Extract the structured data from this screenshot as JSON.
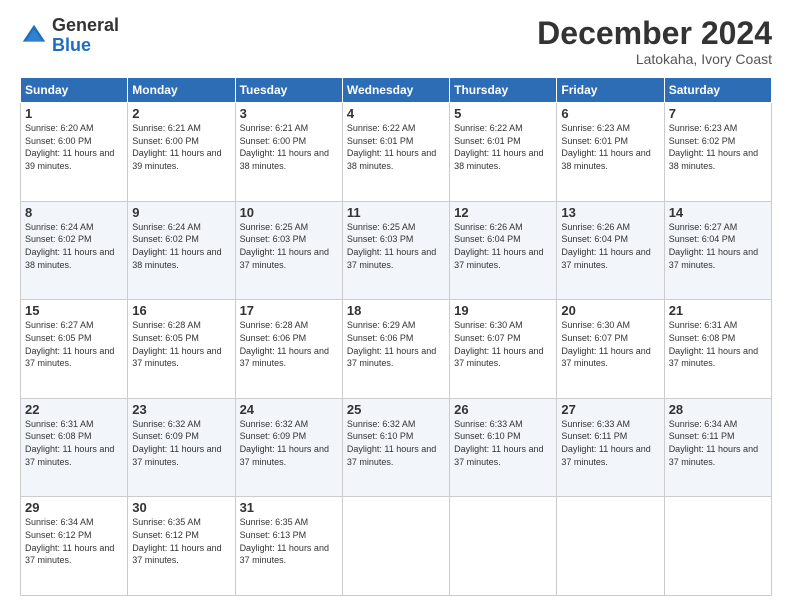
{
  "logo": {
    "general": "General",
    "blue": "Blue"
  },
  "header": {
    "month": "December 2024",
    "location": "Latokaha, Ivory Coast"
  },
  "weekdays": [
    "Sunday",
    "Monday",
    "Tuesday",
    "Wednesday",
    "Thursday",
    "Friday",
    "Saturday"
  ],
  "weeks": [
    [
      {
        "day": "1",
        "sunrise": "6:20 AM",
        "sunset": "6:00 PM",
        "daylight": "11 hours and 39 minutes."
      },
      {
        "day": "2",
        "sunrise": "6:21 AM",
        "sunset": "6:00 PM",
        "daylight": "11 hours and 39 minutes."
      },
      {
        "day": "3",
        "sunrise": "6:21 AM",
        "sunset": "6:00 PM",
        "daylight": "11 hours and 38 minutes."
      },
      {
        "day": "4",
        "sunrise": "6:22 AM",
        "sunset": "6:01 PM",
        "daylight": "11 hours and 38 minutes."
      },
      {
        "day": "5",
        "sunrise": "6:22 AM",
        "sunset": "6:01 PM",
        "daylight": "11 hours and 38 minutes."
      },
      {
        "day": "6",
        "sunrise": "6:23 AM",
        "sunset": "6:01 PM",
        "daylight": "11 hours and 38 minutes."
      },
      {
        "day": "7",
        "sunrise": "6:23 AM",
        "sunset": "6:02 PM",
        "daylight": "11 hours and 38 minutes."
      }
    ],
    [
      {
        "day": "8",
        "sunrise": "6:24 AM",
        "sunset": "6:02 PM",
        "daylight": "11 hours and 38 minutes."
      },
      {
        "day": "9",
        "sunrise": "6:24 AM",
        "sunset": "6:02 PM",
        "daylight": "11 hours and 38 minutes."
      },
      {
        "day": "10",
        "sunrise": "6:25 AM",
        "sunset": "6:03 PM",
        "daylight": "11 hours and 37 minutes."
      },
      {
        "day": "11",
        "sunrise": "6:25 AM",
        "sunset": "6:03 PM",
        "daylight": "11 hours and 37 minutes."
      },
      {
        "day": "12",
        "sunrise": "6:26 AM",
        "sunset": "6:04 PM",
        "daylight": "11 hours and 37 minutes."
      },
      {
        "day": "13",
        "sunrise": "6:26 AM",
        "sunset": "6:04 PM",
        "daylight": "11 hours and 37 minutes."
      },
      {
        "day": "14",
        "sunrise": "6:27 AM",
        "sunset": "6:04 PM",
        "daylight": "11 hours and 37 minutes."
      }
    ],
    [
      {
        "day": "15",
        "sunrise": "6:27 AM",
        "sunset": "6:05 PM",
        "daylight": "11 hours and 37 minutes."
      },
      {
        "day": "16",
        "sunrise": "6:28 AM",
        "sunset": "6:05 PM",
        "daylight": "11 hours and 37 minutes."
      },
      {
        "day": "17",
        "sunrise": "6:28 AM",
        "sunset": "6:06 PM",
        "daylight": "11 hours and 37 minutes."
      },
      {
        "day": "18",
        "sunrise": "6:29 AM",
        "sunset": "6:06 PM",
        "daylight": "11 hours and 37 minutes."
      },
      {
        "day": "19",
        "sunrise": "6:30 AM",
        "sunset": "6:07 PM",
        "daylight": "11 hours and 37 minutes."
      },
      {
        "day": "20",
        "sunrise": "6:30 AM",
        "sunset": "6:07 PM",
        "daylight": "11 hours and 37 minutes."
      },
      {
        "day": "21",
        "sunrise": "6:31 AM",
        "sunset": "6:08 PM",
        "daylight": "11 hours and 37 minutes."
      }
    ],
    [
      {
        "day": "22",
        "sunrise": "6:31 AM",
        "sunset": "6:08 PM",
        "daylight": "11 hours and 37 minutes."
      },
      {
        "day": "23",
        "sunrise": "6:32 AM",
        "sunset": "6:09 PM",
        "daylight": "11 hours and 37 minutes."
      },
      {
        "day": "24",
        "sunrise": "6:32 AM",
        "sunset": "6:09 PM",
        "daylight": "11 hours and 37 minutes."
      },
      {
        "day": "25",
        "sunrise": "6:32 AM",
        "sunset": "6:10 PM",
        "daylight": "11 hours and 37 minutes."
      },
      {
        "day": "26",
        "sunrise": "6:33 AM",
        "sunset": "6:10 PM",
        "daylight": "11 hours and 37 minutes."
      },
      {
        "day": "27",
        "sunrise": "6:33 AM",
        "sunset": "6:11 PM",
        "daylight": "11 hours and 37 minutes."
      },
      {
        "day": "28",
        "sunrise": "6:34 AM",
        "sunset": "6:11 PM",
        "daylight": "11 hours and 37 minutes."
      }
    ],
    [
      {
        "day": "29",
        "sunrise": "6:34 AM",
        "sunset": "6:12 PM",
        "daylight": "11 hours and 37 minutes."
      },
      {
        "day": "30",
        "sunrise": "6:35 AM",
        "sunset": "6:12 PM",
        "daylight": "11 hours and 37 minutes."
      },
      {
        "day": "31",
        "sunrise": "6:35 AM",
        "sunset": "6:13 PM",
        "daylight": "11 hours and 37 minutes."
      },
      null,
      null,
      null,
      null
    ]
  ]
}
